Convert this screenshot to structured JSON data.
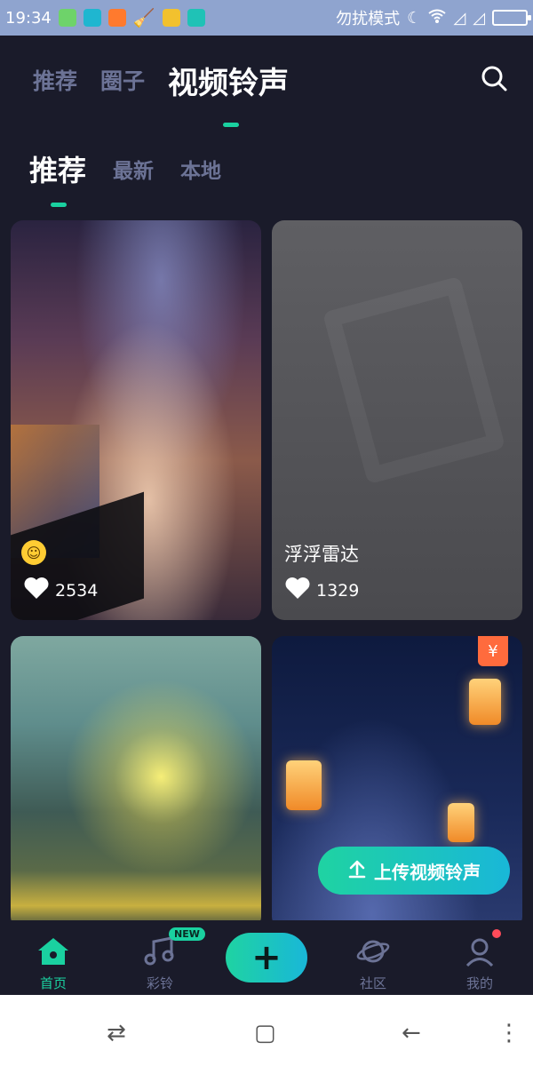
{
  "status_bar": {
    "time": "19:34",
    "mode_text": "勿扰模式",
    "notification_icons": [
      "app-icon",
      "sync-icon",
      "warning-icon",
      "broom-icon",
      "folder-icon",
      "usb-icon"
    ],
    "right_icons": [
      "moon-icon",
      "wifi-icon",
      "signal-icon",
      "signal-icon",
      "battery-icon"
    ]
  },
  "top_nav": {
    "tabs": [
      {
        "label": "推荐",
        "active": false
      },
      {
        "label": "圈子",
        "active": false
      },
      {
        "label": "视频铃声",
        "active": true
      }
    ]
  },
  "sub_nav": {
    "tabs": [
      {
        "label": "推荐",
        "active": true
      },
      {
        "label": "最新",
        "active": false
      },
      {
        "label": "本地",
        "active": false
      }
    ]
  },
  "cards": [
    {
      "title": "",
      "likes": "2534",
      "has_emoji": true
    },
    {
      "title": "浮浮雷达",
      "likes": "1329"
    },
    {
      "title": "",
      "likes": ""
    },
    {
      "title": "",
      "likes": "",
      "badge": "¥"
    }
  ],
  "upload_button": {
    "label": "上传视频铃声"
  },
  "bottom_tabs": [
    {
      "label": "首页",
      "icon": "home-icon",
      "active": true
    },
    {
      "label": "彩铃",
      "icon": "music-note-icon",
      "badge": "NEW"
    },
    {
      "label": "",
      "icon": "plus-icon"
    },
    {
      "label": "社区",
      "icon": "planet-icon"
    },
    {
      "label": "我的",
      "icon": "user-icon",
      "dot": true
    }
  ],
  "colors": {
    "accent": "#1ad1a0",
    "background": "#1a1b2a",
    "inactive_text": "#6c7396",
    "status_bar": "#8fa4cf"
  }
}
